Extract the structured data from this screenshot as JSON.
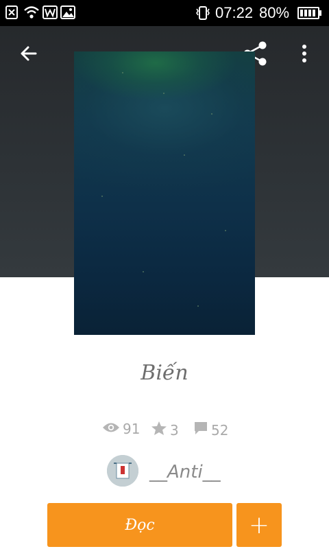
{
  "status_bar": {
    "time": "07:22",
    "battery": "80%",
    "icons": [
      "close-box-icon",
      "wifi-icon",
      "w-app-icon",
      "image-icon",
      "vibrate-icon",
      "battery-icon"
    ]
  },
  "toolbar": {
    "back_icon": "arrow-left-icon",
    "share_icon": "share-icon",
    "more_icon": "more-vertical-icon"
  },
  "story": {
    "title": "Biến",
    "stats": {
      "views": "91",
      "votes": "3",
      "comments": "52"
    },
    "author": "__Anti__"
  },
  "actions": {
    "read_label": "Đọc",
    "add_label": "+"
  },
  "colors": {
    "accent": "#f7941d",
    "header": "#2d3236",
    "status_bar": "#000000"
  }
}
